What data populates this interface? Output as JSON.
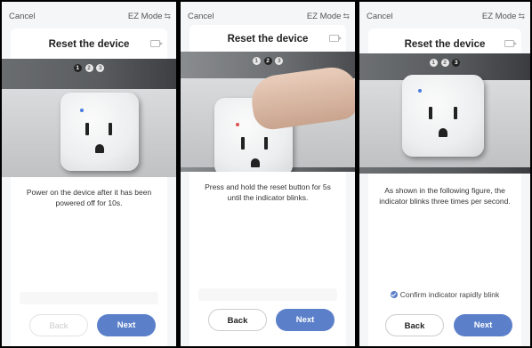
{
  "panels": [
    {
      "cancel": "Cancel",
      "mode": "EZ Mode",
      "title": "Reset the device",
      "steps": [
        "1",
        "2",
        "3"
      ],
      "active_step": 1,
      "description": "Power on the device after it has been powered off for 10s.",
      "back": "Back",
      "next": "Next"
    },
    {
      "cancel": "Cancel",
      "mode": "EZ Mode",
      "title": "Reset the device",
      "steps": [
        "1",
        "2",
        "3"
      ],
      "active_step": 2,
      "description": "Press and hold the reset button for 5s until the indicator blinks.",
      "back": "Back",
      "next": "Next"
    },
    {
      "cancel": "Cancel",
      "mode": "EZ Mode",
      "title": "Reset the device",
      "steps": [
        "1",
        "2",
        "3"
      ],
      "active_step": 3,
      "description": "As shown in the following figure, the indicator blinks three times per second.",
      "confirm": "Confirm indicator rapidly blink",
      "back": "Back",
      "next": "Next"
    }
  ],
  "colors": {
    "accent": "#5b7fc9",
    "panel_bg": "#f5f6f8",
    "led_blue": "#4a7be0",
    "led_red": "#e05050"
  },
  "icons": {
    "mode_switch": "swap-icon",
    "video": "video-icon",
    "confirm": "checkmark-icon"
  }
}
